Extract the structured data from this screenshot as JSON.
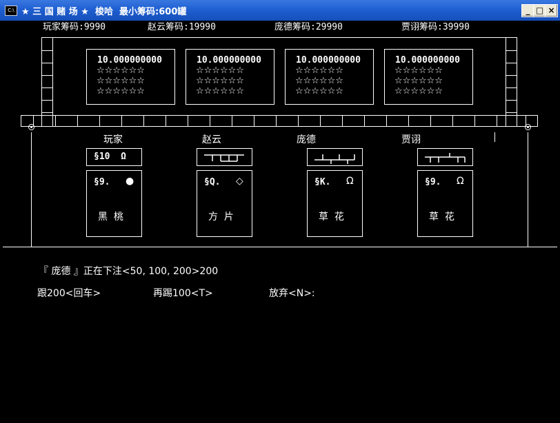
{
  "window": {
    "title": "★ 三 国 赌 场 ★  梭哈  最小筹码:600罐",
    "icon_label": "C:\\",
    "minimize_icon": "minimize-icon",
    "maximize_icon": "maximize-icon",
    "close_icon": "close-icon"
  },
  "chips": [
    {
      "label": "玩家筹码:9990"
    },
    {
      "label": "赵云筹码:19990"
    },
    {
      "label": "庞德筹码:29990"
    },
    {
      "label": "贾诩筹码:39990"
    }
  ],
  "pots": [
    {
      "value": "10.000000000"
    },
    {
      "value": "10.000000000"
    },
    {
      "value": "10.000000000"
    },
    {
      "value": "10.000000000"
    }
  ],
  "star_row": "☆☆☆☆☆☆",
  "players": [
    {
      "name": "玩家",
      "top_card": "§10  Ω",
      "card": "§9.",
      "suit_symbol": "●",
      "suit_icon": "black-circle-icon",
      "suit_name": "黑  桃"
    },
    {
      "name": "赵云",
      "top_card": "",
      "card": "§Q.",
      "suit_symbol": "◇",
      "suit_icon": "diamond-icon",
      "suit_name": "方  片"
    },
    {
      "name": "庞德",
      "top_card": "",
      "card": "§K.",
      "suit_symbol": "Ω",
      "suit_icon": "omega-icon",
      "suit_name": "草  花"
    },
    {
      "name": "贾诩",
      "top_card": "",
      "card": "§9.",
      "suit_symbol": "Ω",
      "suit_icon": "omega-icon",
      "suit_name": "草  花"
    }
  ],
  "status_line": "『 庞德 』正在下注<50, 100, 200>200",
  "options": {
    "follow": "跟200<回车>",
    "raise": "再踢100<T>",
    "fold": "放弃<N>:"
  }
}
